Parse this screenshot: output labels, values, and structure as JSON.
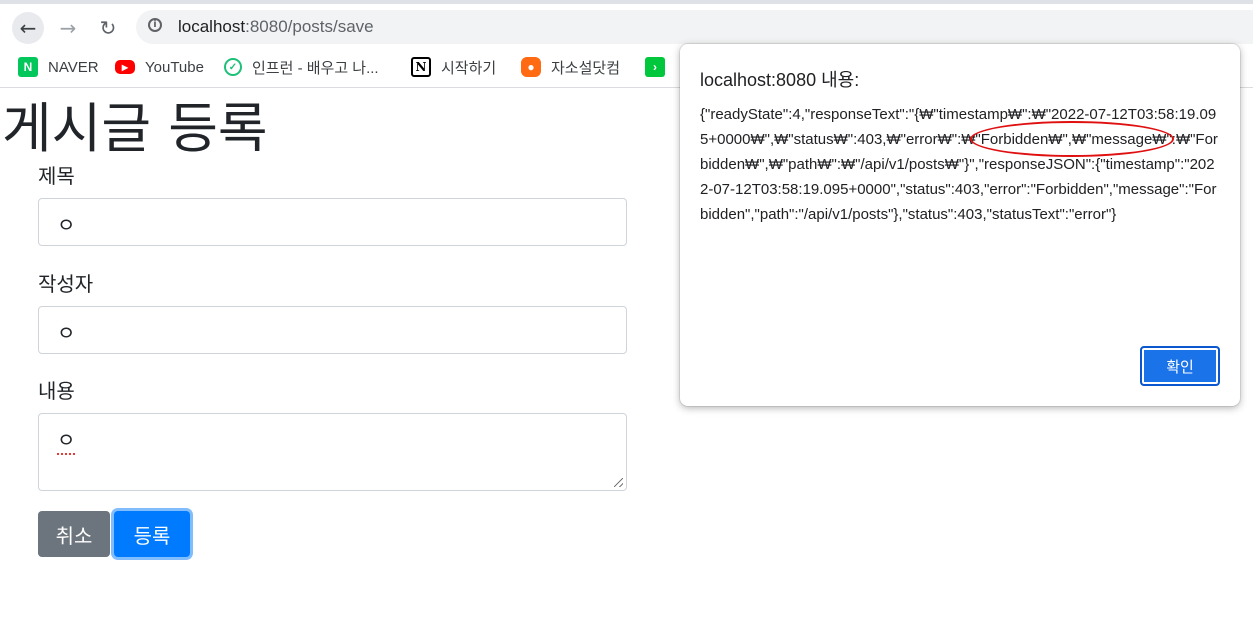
{
  "browser": {
    "url_host": "localhost",
    "url_rest": ":8080/posts/save",
    "bookmarks": [
      {
        "label": "NAVER",
        "icon": "naver-icon"
      },
      {
        "label": "YouTube",
        "icon": "youtube-icon"
      },
      {
        "label": "인프런 - 배우고 나...",
        "icon": "inflearn-icon"
      },
      {
        "label": "시작하기",
        "icon": "notion-icon"
      },
      {
        "label": "자소설닷컴",
        "icon": "jasoseol-icon"
      }
    ]
  },
  "page": {
    "title": "게시글 등록",
    "fields": [
      {
        "label": "제목",
        "value": "ㅇ"
      },
      {
        "label": "작성자",
        "value": "ㅇ"
      },
      {
        "label": "내용",
        "value": "ㅇ"
      }
    ],
    "cancel_label": "취소",
    "submit_label": "등록"
  },
  "dialog": {
    "title": "localhost:8080 내용:",
    "message": "{\"readyState\":4,\"responseText\":\"{₩\"timestamp₩\":₩\"2022-07-12T03:58:19.095+0000₩\",₩\"status₩\":403,₩\"error₩\":₩\"Forbidden₩\",₩\"message₩\":₩\"Forbidden₩\",₩\"path₩\":₩\"/api/v1/posts₩\"}\",\"responseJSON\":{\"timestamp\":\"2022-07-12T03:58:19.095+0000\",\"status\":403,\"error\":\"Forbidden\",\"message\":\"Forbidden\",\"path\":\"/api/v1/posts\"},\"status\":403,\"statusText\":\"error\"}",
    "ok_label": "확인"
  },
  "colors": {
    "primary": "#007bff",
    "secondary": "#6c757d",
    "dialog_button": "#1a73e8",
    "annotation": "#e01010"
  }
}
